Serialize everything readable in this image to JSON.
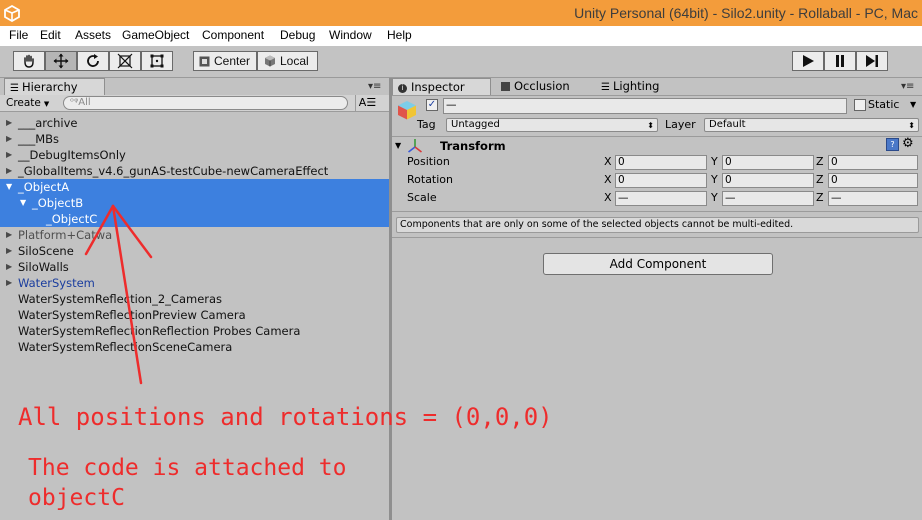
{
  "window": {
    "title": "Unity Personal (64bit) - Silo2.unity - Rollaball - PC, Mac"
  },
  "menu": [
    "File",
    "Edit",
    "Assets",
    "GameObject",
    "Component",
    "Debug",
    "Window",
    "Help"
  ],
  "toolbar": {
    "tools": [
      "hand-tool",
      "move-tool",
      "rotate-tool",
      "scale-tool",
      "rect-tool"
    ],
    "pivot_label": "Center",
    "space_label": "Local"
  },
  "hierarchy": {
    "tab_label": "Hierarchy",
    "create_label": "Create",
    "search_placeholder": "All",
    "items": [
      {
        "label": "___archive",
        "arrow": "▶",
        "state": "normal"
      },
      {
        "label": "___MBs",
        "arrow": "▶",
        "state": "normal"
      },
      {
        "label": "__DebugItemsOnly",
        "arrow": "▶",
        "state": "normal"
      },
      {
        "label": "_GlobalItems_v4.6_gunAS-testCube-newCameraEffect",
        "arrow": "▶",
        "state": "normal"
      },
      {
        "label": "_ObjectA",
        "arrow": "▼",
        "state": "selected"
      },
      {
        "label": "_ObjectB",
        "arrow": "▼",
        "state": "selected"
      },
      {
        "label": "_ObjectC",
        "arrow": "",
        "state": "selected"
      },
      {
        "label": "Platform+Catwa",
        "arrow": "▶",
        "state": "dim"
      },
      {
        "label": "SiloScene",
        "arrow": "▶",
        "state": "normal"
      },
      {
        "label": "SiloWalls",
        "arrow": "▶",
        "state": "normal"
      },
      {
        "label": "WaterSystem",
        "arrow": "▶",
        "state": "prefab"
      },
      {
        "label": "WaterSystemReflection_2_Cameras",
        "arrow": "",
        "state": "normal"
      },
      {
        "label": "WaterSystemReflectionPreview Camera",
        "arrow": "",
        "state": "normal"
      },
      {
        "label": "WaterSystemReflectionReflection Probes Camera",
        "arrow": "",
        "state": "normal"
      },
      {
        "label": "WaterSystemReflectionSceneCamera",
        "arrow": "",
        "state": "normal"
      }
    ]
  },
  "inspector": {
    "tabs": [
      "Inspector",
      "Occlusion",
      "Lighting"
    ],
    "name_value": "—",
    "static_label": "Static",
    "tag_label": "Tag",
    "tag_value": "Untagged",
    "layer_label": "Layer",
    "layer_value": "Default",
    "transform_title": "Transform",
    "rows": [
      {
        "label": "Position",
        "x": "0",
        "y": "0",
        "z": "0"
      },
      {
        "label": "Rotation",
        "x": "0",
        "y": "0",
        "z": "0"
      },
      {
        "label": "Scale",
        "x": "—",
        "y": "—",
        "z": "—"
      }
    ],
    "axis_labels": [
      "X",
      "Y",
      "Z"
    ],
    "notice": "Components that are only on some of the selected objects cannot be multi-edited.",
    "add_component_label": "Add Component"
  },
  "annotations": {
    "line1": "All positions and rotations = (0,0,0)",
    "line2": "The code is attached to",
    "line3": "objectC"
  },
  "colors": {
    "title_bar": "#f39c3b",
    "selection": "#3d80df",
    "annotation": "#ee2c2c",
    "prefab_text": "#1a3d9e"
  }
}
